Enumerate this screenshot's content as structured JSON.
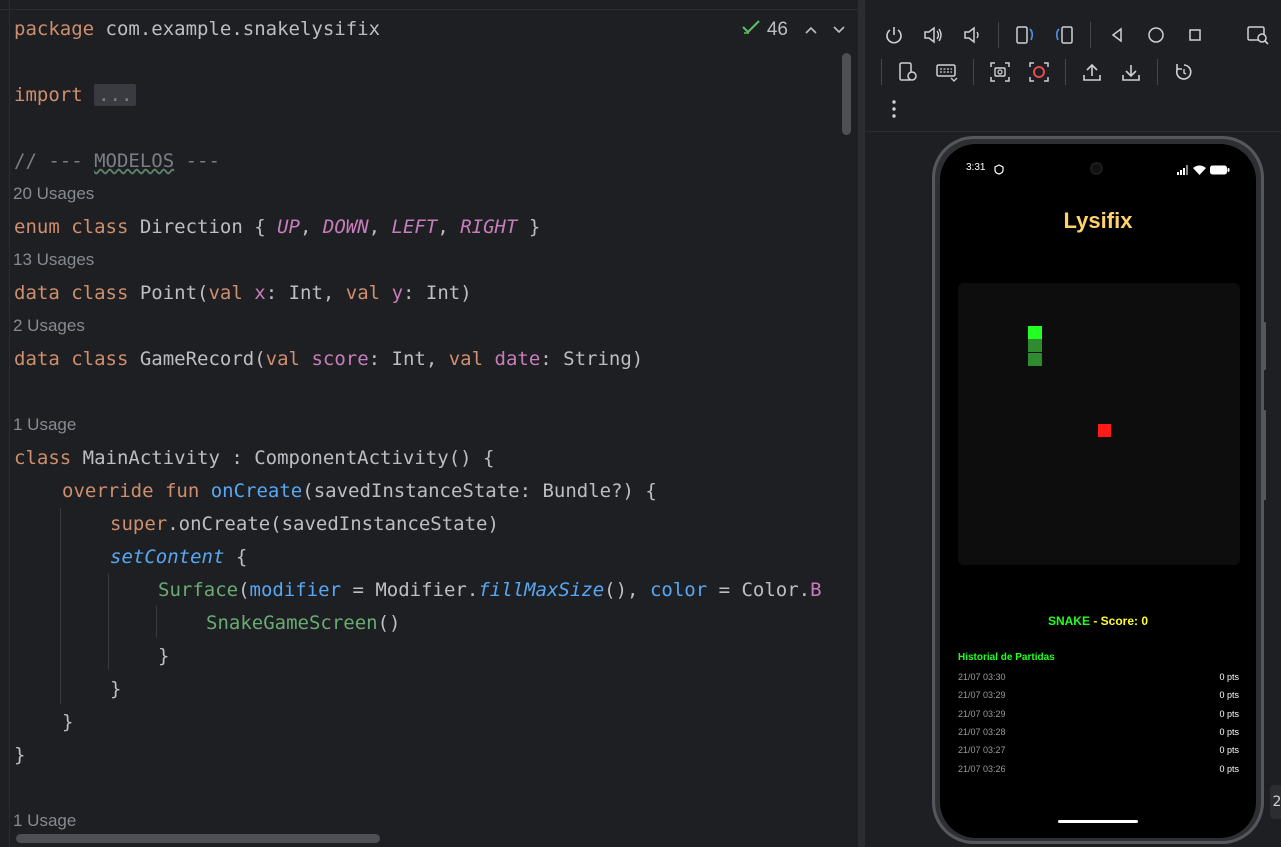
{
  "editor": {
    "package_kw": "package",
    "package_name": " com.example.snakelysifix",
    "import_kw": "import",
    "import_fold": "...",
    "comment_prefix": "// --- ",
    "comment_word": "MODELOS",
    "comment_suffix": " ---",
    "hint_direction": "20 Usages",
    "hint_point": "13 Usages",
    "hint_gamerecord": "2 Usages",
    "hint_mainactivity": "1 Usage",
    "hint_bottom": "1 Usage",
    "l_enum_kw": "enum class",
    "l_enum_name": " Direction { ",
    "l_enum_up": "UP",
    "l_enum_down": "DOWN",
    "l_enum_left": "LEFT",
    "l_enum_right": "RIGHT",
    "l_enum_close": " }",
    "l_point_kw": "data class",
    "l_point_name": " Point(",
    "l_point_val1": "val",
    "l_point_x": "x",
    "l_point_t1": ": Int, ",
    "l_point_val2": "val",
    "l_point_y": "y",
    "l_point_t2": ": Int)",
    "l_gr_kw": "data class",
    "l_gr_name": " GameRecord(",
    "l_gr_val1": "val",
    "l_gr_score": "score",
    "l_gr_t1": ": Int, ",
    "l_gr_val2": "val",
    "l_gr_date": "date",
    "l_gr_t2": ": String)",
    "l_ma_kw": "class",
    "l_ma_rest": " MainActivity : ComponentActivity() {",
    "l_oc_kw": "override fun",
    "l_oc_fn": "onCreate",
    "l_oc_rest": "(savedInstanceState: Bundle?) {",
    "l_super_kw": "super",
    "l_super_rest": ".onCreate(savedInstanceState)",
    "l_setcontent": "setContent",
    "l_setcontent_rest": " {",
    "l_surface": "Surface",
    "l_surface_p1": "(",
    "l_surface_mod": "modifier",
    "l_surface_p2": " = Modifier.",
    "l_surface_fill": "fillMaxSize",
    "l_surface_p3": "(), ",
    "l_surface_color": "color",
    "l_surface_p4": " = Color.",
    "l_surface_b": "B",
    "l_snake": "SnakeGameScreen",
    "l_snake_rest": "()",
    "brace": "}"
  },
  "inspection": {
    "count": "46",
    "check_icon": "check-icon",
    "prev_icon": "chevron-up-icon",
    "next_icon": "chevron-down-icon"
  },
  "device_toolbar": {
    "row1": [
      "power-icon",
      "volume-up-icon",
      "volume-down-icon",
      "rotate-left-icon",
      "rotate-right-icon",
      "back-icon",
      "home-icon",
      "overview-icon",
      "screenshot-search-icon"
    ],
    "row2": [
      "device-settings-icon",
      "keyboard-icon",
      "screenshot-icon",
      "screen-record-icon",
      "upload-icon",
      "download-icon",
      "reset-icon"
    ],
    "more_icon": "more-vertical-icon"
  },
  "phone": {
    "status_time": "3:31",
    "app_title": "Lysifix",
    "score_label_game": "SNAKE",
    "score_label_sep": " - ",
    "score_label_score": "Score: 0",
    "history_title": "Historial de Partidas",
    "history": [
      {
        "date": "21/07 03:30",
        "points": "0 pts"
      },
      {
        "date": "21/07 03:29",
        "points": "0 pts"
      },
      {
        "date": "21/07 03:29",
        "points": "0 pts"
      },
      {
        "date": "21/07 03:28",
        "points": "0 pts"
      },
      {
        "date": "21/07 03:27",
        "points": "0 pts"
      },
      {
        "date": "21/07 03:26",
        "points": "0 pts"
      }
    ],
    "colors": {
      "title": "#ffd36b",
      "snake_head": "#22ff22",
      "snake_body": "#2e8b2e",
      "food": "#ff1a1a",
      "game_label": "#22ff22",
      "score": "#ffff33"
    }
  },
  "edge_tab_label": "2"
}
